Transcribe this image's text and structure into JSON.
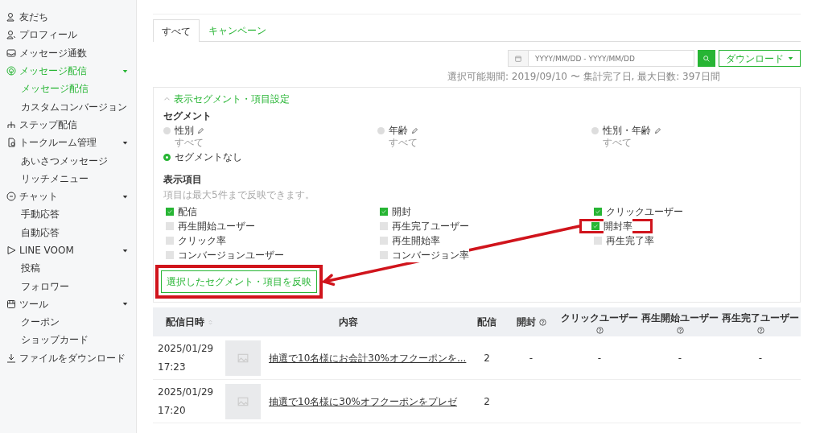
{
  "sidebar": {
    "items": [
      {
        "label": "友だち",
        "selected": false
      },
      {
        "label": "プロフィール",
        "selected": false
      },
      {
        "label": "メッセージ通数",
        "selected": false
      },
      {
        "label": "メッセージ配信",
        "selected": true,
        "expanded": true,
        "children": [
          {
            "label": "メッセージ配信",
            "selected": true
          },
          {
            "label": "カスタムコンバージョン",
            "selected": false
          }
        ]
      },
      {
        "label": "ステップ配信",
        "selected": false
      },
      {
        "label": "トークルーム管理",
        "selected": false,
        "expanded": true,
        "children": [
          {
            "label": "あいさつメッセージ",
            "selected": false
          },
          {
            "label": "リッチメニュー",
            "selected": false
          }
        ]
      },
      {
        "label": "チャット",
        "selected": false,
        "expanded": true,
        "children": [
          {
            "label": "手動応答",
            "selected": false
          },
          {
            "label": "自動応答",
            "selected": false
          }
        ]
      },
      {
        "label": "LINE VOOM",
        "selected": false,
        "expanded": true,
        "children": [
          {
            "label": "投稿",
            "selected": false
          },
          {
            "label": "フォロワー",
            "selected": false
          }
        ]
      },
      {
        "label": "ツール",
        "selected": false,
        "expanded": true,
        "children": [
          {
            "label": "クーポン",
            "selected": false
          },
          {
            "label": "ショップカード",
            "selected": false
          }
        ]
      },
      {
        "label": "ファイルをダウンロード",
        "selected": false
      }
    ]
  },
  "tabs": [
    {
      "label": "すべて",
      "selected": true
    },
    {
      "label": "キャンペーン",
      "selected": false
    }
  ],
  "date_range": {
    "placeholder": "YYYY/MM/DD - YYYY/MM/DD"
  },
  "download_button": "ダウンロード",
  "range_hint": "選択可能期間: 2019/09/10 〜 集計完了日, 最大日数: 397日間",
  "settings": {
    "title": "表示セグメント・項目設定",
    "expanded": true,
    "segment_heading": "セグメント",
    "segments": [
      {
        "label": "性別",
        "sub": "すべて",
        "selected": false
      },
      {
        "label": "年齢",
        "sub": "すべて",
        "selected": false
      },
      {
        "label": "性別・年齢",
        "sub": "すべて",
        "selected": false
      },
      {
        "label": "セグメントなし",
        "selected": true
      }
    ],
    "items_heading": "表示項目",
    "items_hint": "項目は最大5件まで反映できます。",
    "columns": [
      [
        {
          "label": "配信",
          "checked": true,
          "highlighted": false
        },
        {
          "label": "再生開始ユーザー",
          "checked": false,
          "highlighted": false
        },
        {
          "label": "クリック率",
          "checked": false,
          "highlighted": false
        },
        {
          "label": "コンバージョンユーザー",
          "checked": false,
          "highlighted": false
        }
      ],
      [
        {
          "label": "開封",
          "checked": true,
          "highlighted": false
        },
        {
          "label": "再生完了ユーザー",
          "checked": false,
          "highlighted": false
        },
        {
          "label": "再生開始率",
          "checked": false,
          "highlighted": false
        },
        {
          "label": "コンバージョン率",
          "checked": false,
          "highlighted": false
        }
      ],
      [
        {
          "label": "クリックユーザー",
          "checked": true,
          "highlighted": false
        },
        {
          "label": "開封率",
          "checked": true,
          "highlighted": true
        },
        {
          "label": "再生完了率",
          "checked": false,
          "highlighted": false
        }
      ]
    ],
    "apply_button": {
      "label": "選択したセグメント・項目を反映",
      "highlighted": true
    }
  },
  "table": {
    "columns": [
      {
        "label": "配信日時",
        "kind": "sort"
      },
      {
        "label": "内容",
        "kind": "plain"
      },
      {
        "label": "配信",
        "kind": "plain"
      },
      {
        "label": "開封",
        "kind": "help-inline"
      },
      {
        "label": "クリックユーザー",
        "kind": "help-below"
      },
      {
        "label": "再生開始ユーザー",
        "kind": "help-below"
      },
      {
        "label": "再生完了ユーザー",
        "kind": "help-below"
      }
    ],
    "rows": [
      {
        "cells": [
          "2025/01/29 17:23",
          "抽選で10名様にお会計30%オフクーポンを...",
          "2",
          "-",
          "-",
          "-",
          "-"
        ]
      },
      {
        "cells": [
          "2025/01/29 17:20",
          "抽選で10名様に30%オフクーポンをプレゼ",
          "2"
        ]
      }
    ]
  }
}
